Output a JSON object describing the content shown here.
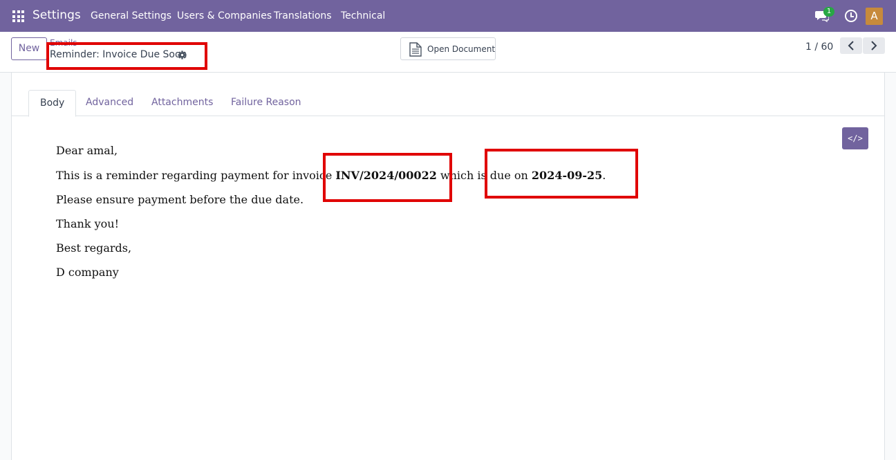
{
  "navbar": {
    "app_name": "Settings",
    "menus": [
      "General Settings",
      "Users & Companies",
      "Translations",
      "Technical"
    ],
    "chat_badge": "1",
    "avatar_letter": "A"
  },
  "control": {
    "new_label": "New",
    "breadcrumb_parent": "Emails",
    "breadcrumb_current": "Reminder: Invoice Due Soon",
    "open_document_label": "Open Document",
    "pager_value": "1 / 60"
  },
  "tabs": [
    "Body",
    "Advanced",
    "Attachments",
    "Failure Reason"
  ],
  "body": {
    "greeting": "Dear amal,",
    "line1_prefix": "This is a reminder regarding payment for invoice ",
    "invoice_number": "INV/2024/00022",
    "line1_middle": " which is due on ",
    "due_date": "2024-09-25",
    "line1_suffix": ".",
    "line2": "Please ensure payment before the due date.",
    "line3": "Thank you!",
    "line4": "Best regards,",
    "line5": "D company"
  },
  "colors": {
    "primary": "#71639e",
    "highlight_box": "#e00000"
  },
  "code_button_label": "</>"
}
